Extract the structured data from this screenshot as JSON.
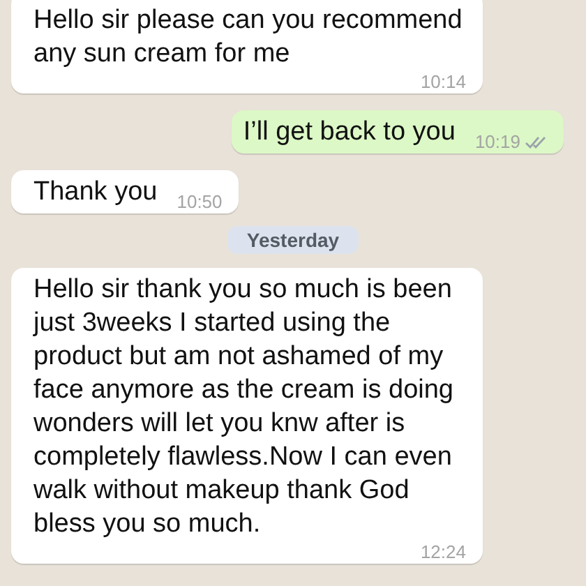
{
  "messages": [
    {
      "kind": "incoming",
      "text": "Hello sir please can you recommend any sun cream for me",
      "time": "10:14"
    },
    {
      "kind": "outgoing",
      "text": "I’ll get back to you",
      "time": "10:19",
      "read": false
    },
    {
      "kind": "incoming",
      "text": "Thank you",
      "time": "10:50"
    },
    {
      "kind": "date",
      "text": "Yesterday"
    },
    {
      "kind": "incoming",
      "text": "Hello sir thank you so much is been just 3weeks I started using the product but am not ashamed of my face anymore as the cream is doing wonders will let you knw after is completely flawless.Now I can even walk without makeup thank God bless you so much.",
      "time": "12:24"
    }
  ]
}
